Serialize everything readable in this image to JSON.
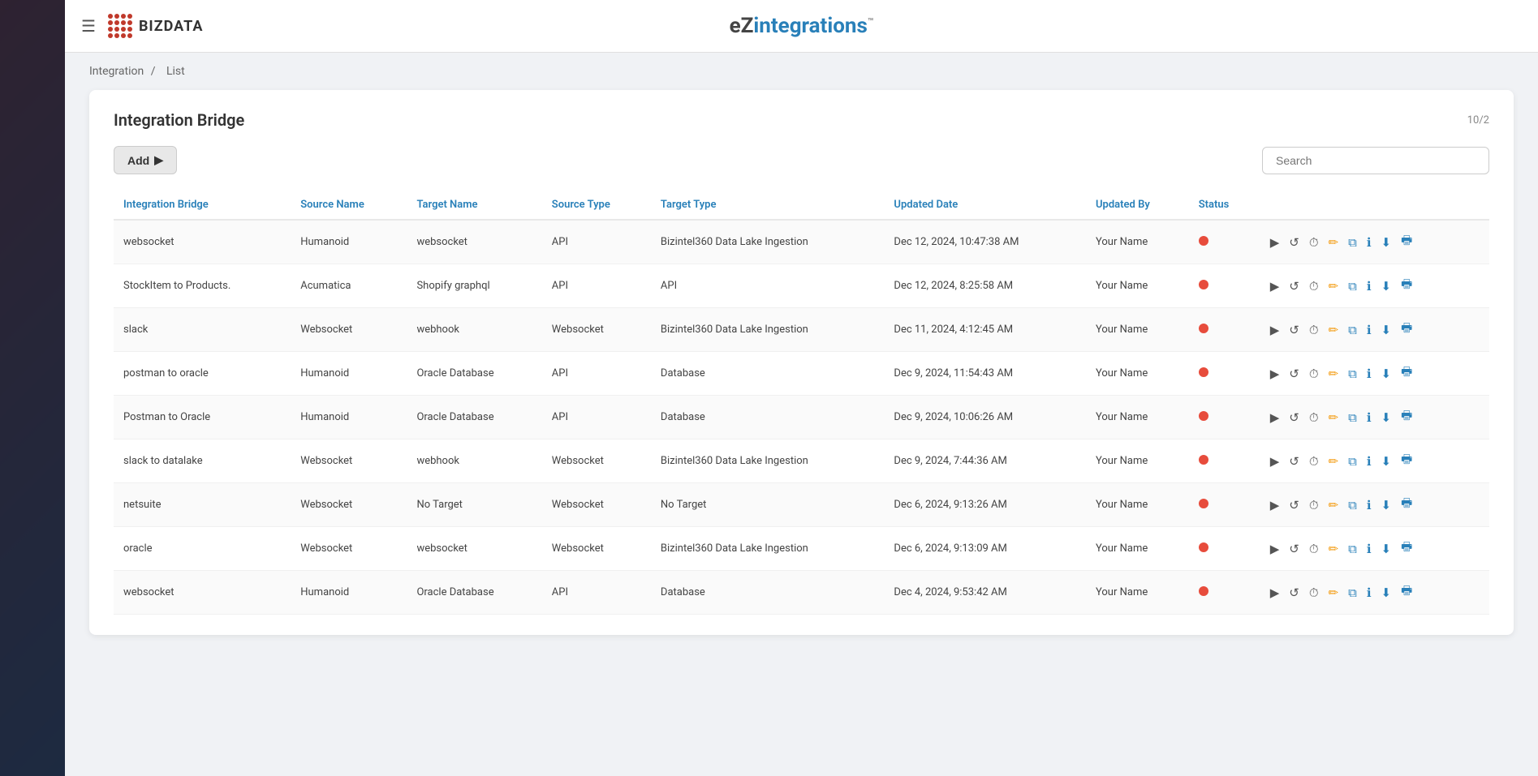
{
  "app": {
    "title_ez": "eZ",
    "title_integrations": "integrations",
    "title_tm": "™",
    "logo_text": "BIZDATA",
    "hamburger": "☰"
  },
  "breadcrumb": {
    "integration": "Integration",
    "separator": "/",
    "list": "List"
  },
  "panel": {
    "title": "Integration Bridge",
    "pagination": "10/2",
    "add_label": "Add",
    "search_placeholder": "Search"
  },
  "table": {
    "columns": [
      "Integration Bridge",
      "Source Name",
      "Target Name",
      "Source Type",
      "Target Type",
      "Updated Date",
      "Updated By",
      "Status"
    ],
    "rows": [
      {
        "integration_bridge": "websocket",
        "source_name": "Humanoid",
        "target_name": "websocket",
        "source_type": "API",
        "target_type": "Bizintel360 Data Lake Ingestion",
        "updated_date": "Dec 12, 2024, 10:47:38 AM",
        "updated_by": "Your Name",
        "status": "inactive"
      },
      {
        "integration_bridge": "StockItem to Products.",
        "source_name": "Acumatica",
        "target_name": "Shopify graphql",
        "source_type": "API",
        "target_type": "API",
        "updated_date": "Dec 12, 2024, 8:25:58 AM",
        "updated_by": "Your Name",
        "status": "inactive"
      },
      {
        "integration_bridge": "slack",
        "source_name": "Websocket",
        "target_name": "webhook",
        "source_type": "Websocket",
        "target_type": "Bizintel360 Data Lake Ingestion",
        "updated_date": "Dec 11, 2024, 4:12:45 AM",
        "updated_by": "Your Name",
        "status": "inactive"
      },
      {
        "integration_bridge": "postman to oracle",
        "source_name": "Humanoid",
        "target_name": "Oracle Database",
        "source_type": "API",
        "target_type": "Database",
        "updated_date": "Dec 9, 2024, 11:54:43 AM",
        "updated_by": "Your Name",
        "status": "inactive"
      },
      {
        "integration_bridge": "Postman to Oracle",
        "source_name": "Humanoid",
        "target_name": "Oracle Database",
        "source_type": "API",
        "target_type": "Database",
        "updated_date": "Dec 9, 2024, 10:06:26 AM",
        "updated_by": "Your Name",
        "status": "inactive"
      },
      {
        "integration_bridge": "slack to datalake",
        "source_name": "Websocket",
        "target_name": "webhook",
        "source_type": "Websocket",
        "target_type": "Bizintel360 Data Lake Ingestion",
        "updated_date": "Dec 9, 2024, 7:44:36 AM",
        "updated_by": "Your Name",
        "status": "inactive"
      },
      {
        "integration_bridge": "netsuite",
        "source_name": "Websocket",
        "target_name": "No Target",
        "source_type": "Websocket",
        "target_type": "No Target",
        "updated_date": "Dec 6, 2024, 9:13:26 AM",
        "updated_by": "Your Name",
        "status": "inactive"
      },
      {
        "integration_bridge": "oracle",
        "source_name": "Websocket",
        "target_name": "websocket",
        "source_type": "Websocket",
        "target_type": "Bizintel360 Data Lake Ingestion",
        "updated_date": "Dec 6, 2024, 9:13:09 AM",
        "updated_by": "Your Name",
        "status": "inactive"
      },
      {
        "integration_bridge": "websocket",
        "source_name": "Humanoid",
        "target_name": "Oracle Database",
        "source_type": "API",
        "target_type": "Database",
        "updated_date": "Dec 4, 2024, 9:53:42 AM",
        "updated_by": "Your Name",
        "status": "inactive"
      }
    ]
  },
  "actions": {
    "play": "▶",
    "reset": "↺",
    "history": "🕐",
    "edit": "✏",
    "copy": "⧉",
    "info": "ℹ",
    "download": "⬇",
    "print": "🖶"
  }
}
